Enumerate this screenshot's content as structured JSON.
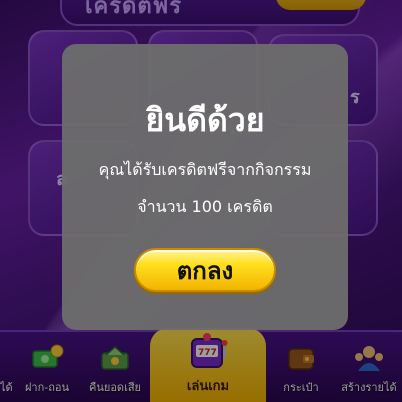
{
  "header": {
    "banner_text": "เครดิตฟรี"
  },
  "dialog": {
    "title": "ยินดีด้วย",
    "line1": "คุณได้รับเครดิตฟรีจากกิจกรรม",
    "line2": "จำนวน 100 เครดิต",
    "ok_label": "ตกลง"
  },
  "bottom_nav": {
    "left_edge": "ได้",
    "items": [
      {
        "label": "ฝาก-ถอน",
        "icon": "deposit-withdraw-icon"
      },
      {
        "label": "คืนยอดเสีย",
        "icon": "cashback-icon"
      },
      {
        "label": "เล่นเกม",
        "icon": "slot-machine-icon"
      },
      {
        "label": "กระเป๋า",
        "icon": "wallet-icon"
      },
      {
        "label": "สร้างรายได้",
        "icon": "affiliate-icon"
      }
    ]
  },
  "colors": {
    "modal_bg": "#6c6c6c",
    "accent_gold": "#ffe01e",
    "nav_bg": "#4a1288"
  }
}
